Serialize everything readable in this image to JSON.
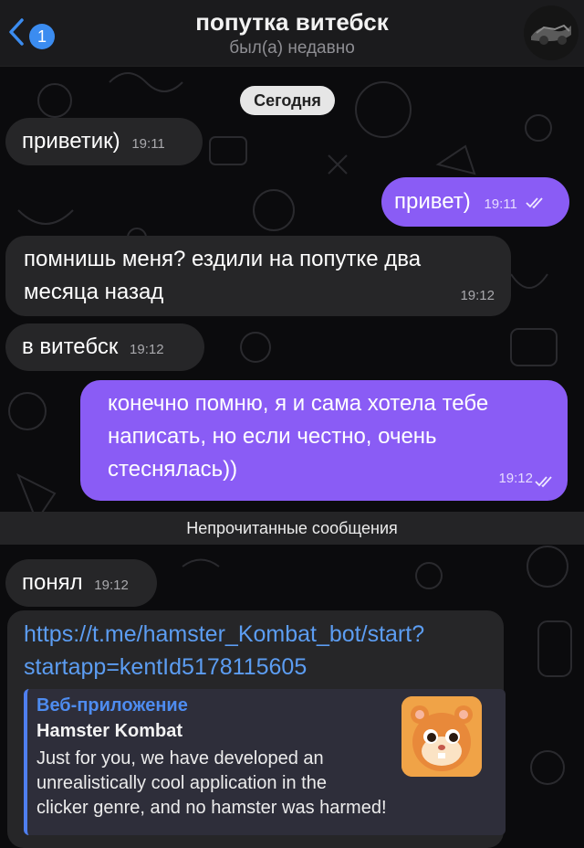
{
  "header": {
    "back_badge": "1",
    "title": "попутка витебск",
    "status": "был(а) недавно"
  },
  "date_chip": "Сегодня",
  "messages": [
    {
      "dir": "in",
      "text": "приветик)",
      "time": "19:11"
    },
    {
      "dir": "out",
      "text": "привет)",
      "time": "19:11"
    },
    {
      "dir": "in",
      "line1": "помнишь меня? ездили на попутке два",
      "line2": "месяца назад",
      "time": "19:12"
    },
    {
      "dir": "in",
      "text": "в витебск",
      "time": "19:12"
    },
    {
      "dir": "out",
      "line1": "конечно помню, я и сама хотела тебе",
      "line2": "написать, но если честно, очень",
      "line3": "стеснялась))",
      "time": "19:12"
    },
    {
      "dir": "in",
      "text": "понял",
      "time": "19:12"
    }
  ],
  "unread_divider": "Непрочитанные сообщения",
  "link_message": {
    "url_line1": "https://t.me/hamster_Kombat_bot/start?",
    "url_line2": "startapp=kentId5178115605",
    "preview": {
      "site": "Веб-приложение",
      "title": "Hamster Kombat",
      "desc_line1": "Just for you, we have developed an",
      "desc_line2": "unrealistically cool application in the",
      "desc_line3": "clicker genre, and no hamster was harmed!"
    }
  },
  "colors": {
    "incoming_bubble": "#262628",
    "outgoing_bubble": "#8a5cf5",
    "link": "#5c9df2",
    "accent": "#3b8cf0"
  }
}
